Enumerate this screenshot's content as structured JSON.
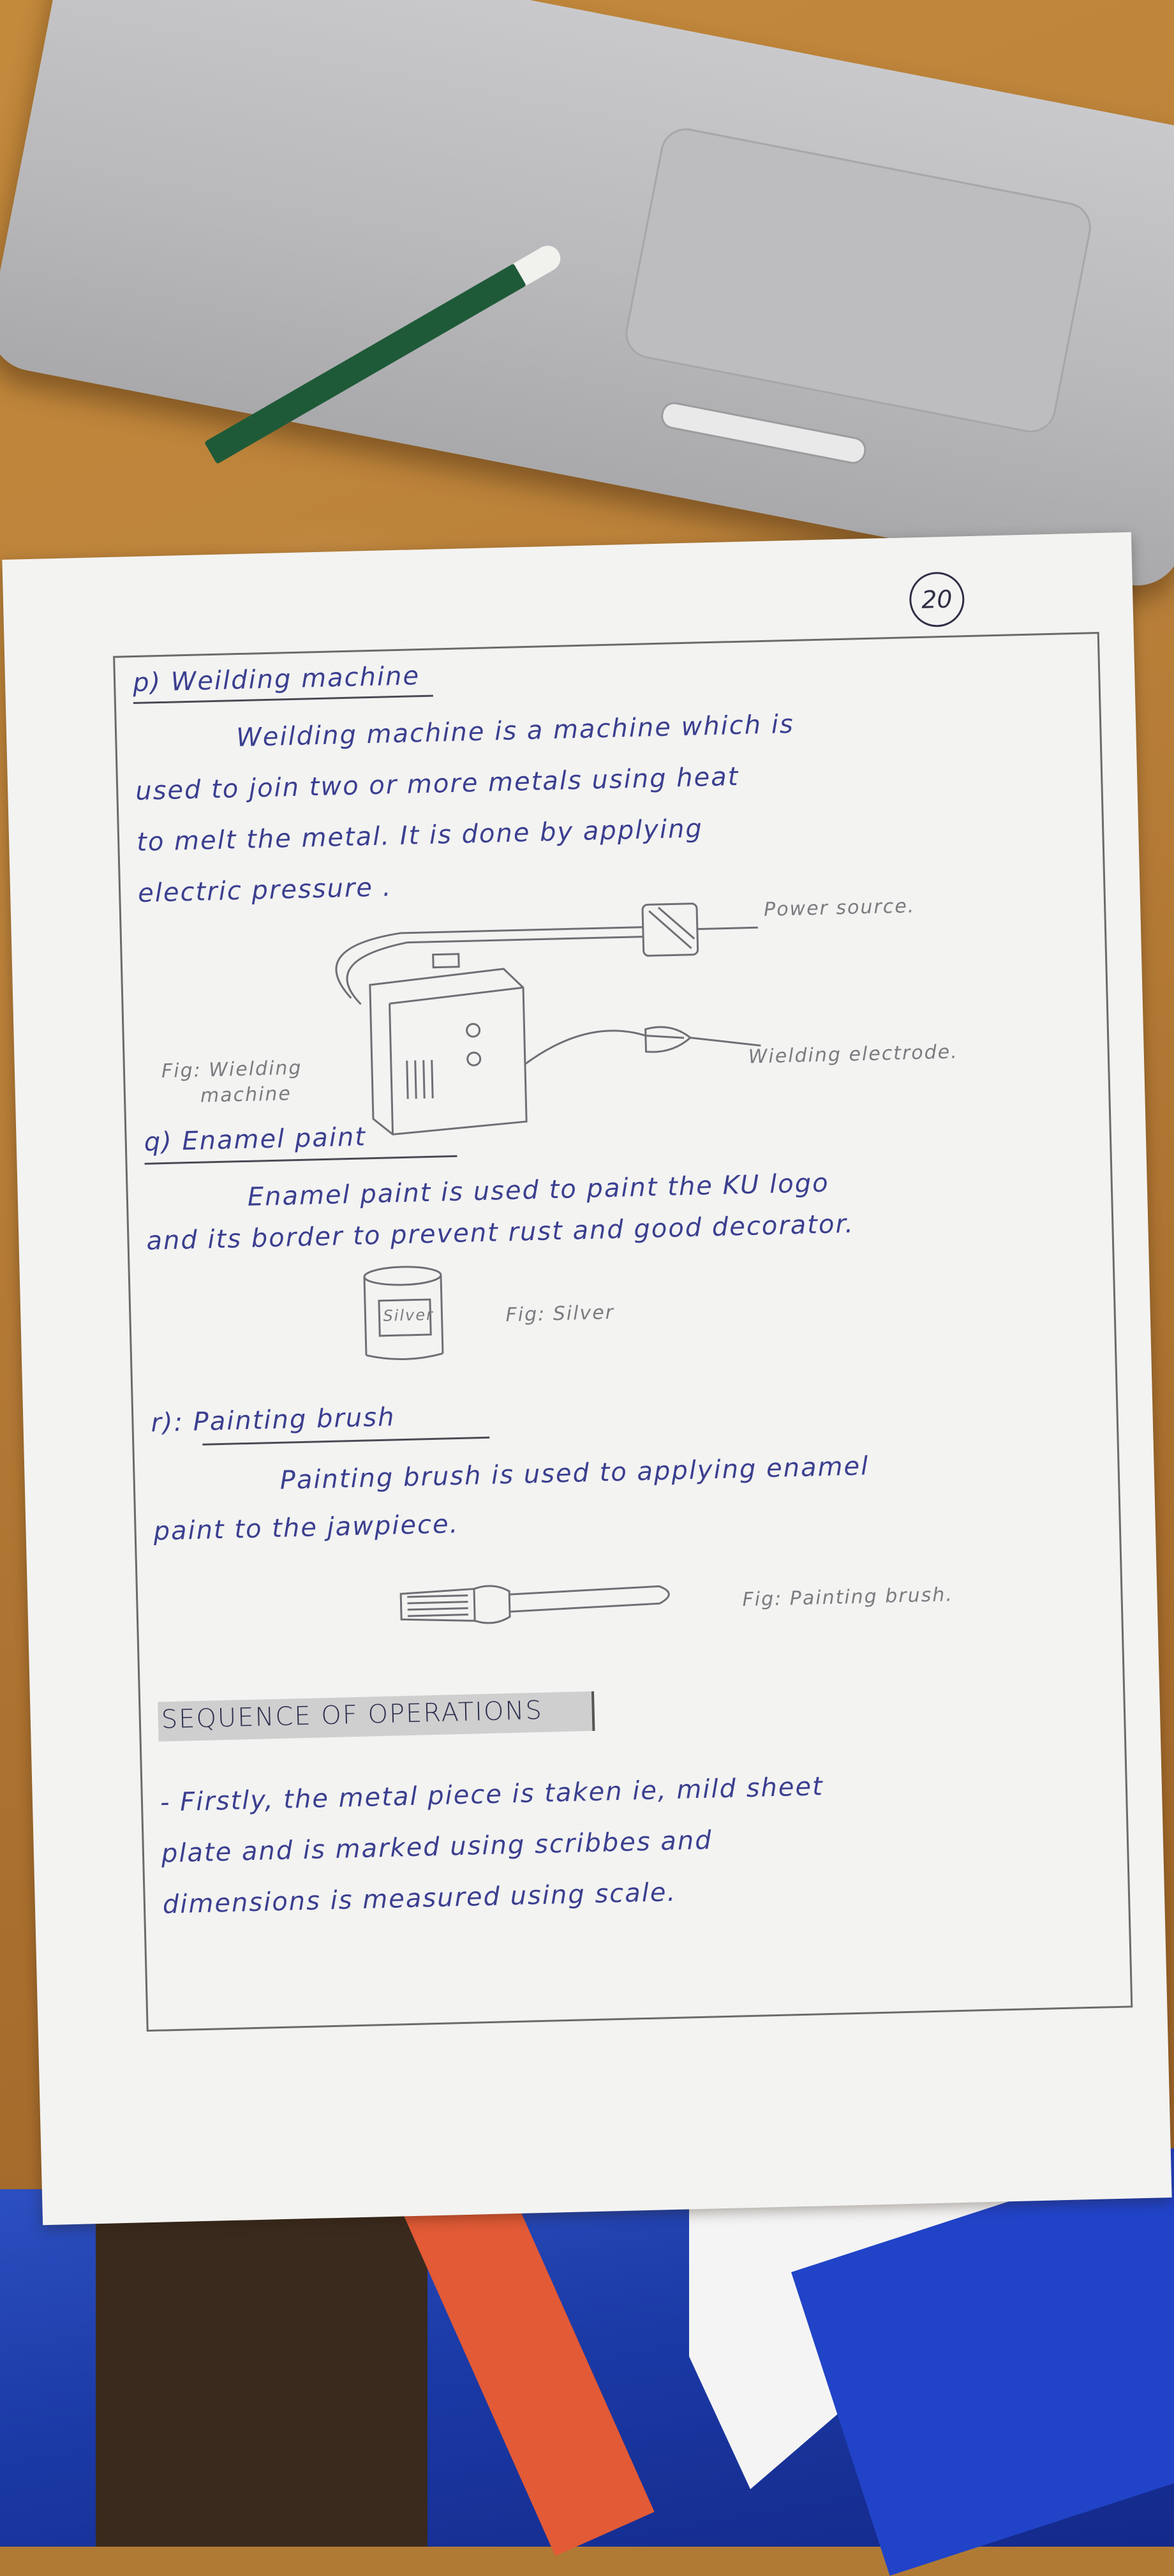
{
  "page_number": "20",
  "welding": {
    "heading": "p) Weilding machine",
    "line1": "Weilding   machine   is   a   machine   which is",
    "line2": "used to  join  two   or   more   metals  using  heat",
    "line3": "to   melt  the  metal.  It is  done  by  applying",
    "line4": "electric  pressure .",
    "power_label": "Power source.",
    "fig_caption_1": "Fig: Wielding",
    "fig_caption_2": "machine",
    "electrode_label": "Wielding electrode."
  },
  "enamel": {
    "heading": "q) Enamel paint",
    "line1": "Enamel  paint  is  used  to  paint  the  KU  logo",
    "line2": "and  its  border  to  prevent  rust  and  good  decorator.",
    "can_label": "Silver",
    "fig_caption": "Fig: Silver"
  },
  "brush": {
    "heading": "r): Painting brush",
    "line1": "Painting  brush  is  used  to  applying  enamel",
    "line2": "paint  to  the  jawpiece.",
    "fig_caption": "Fig: Painting brush."
  },
  "sequence": {
    "heading": "SEQUENCE  OF  OPERATIONS",
    "line1": "-  Firstly,  the   metal  piece  is  taken  ie,  mild  sheet",
    "line2": "plate    and  is    marked  using  scribbes  and",
    "line3": "dimensions    is    measured  using  scale."
  },
  "colors": {
    "ink": "#3b3f8f",
    "pencil": "#7b7b80",
    "paper": "#f3f3f2"
  }
}
